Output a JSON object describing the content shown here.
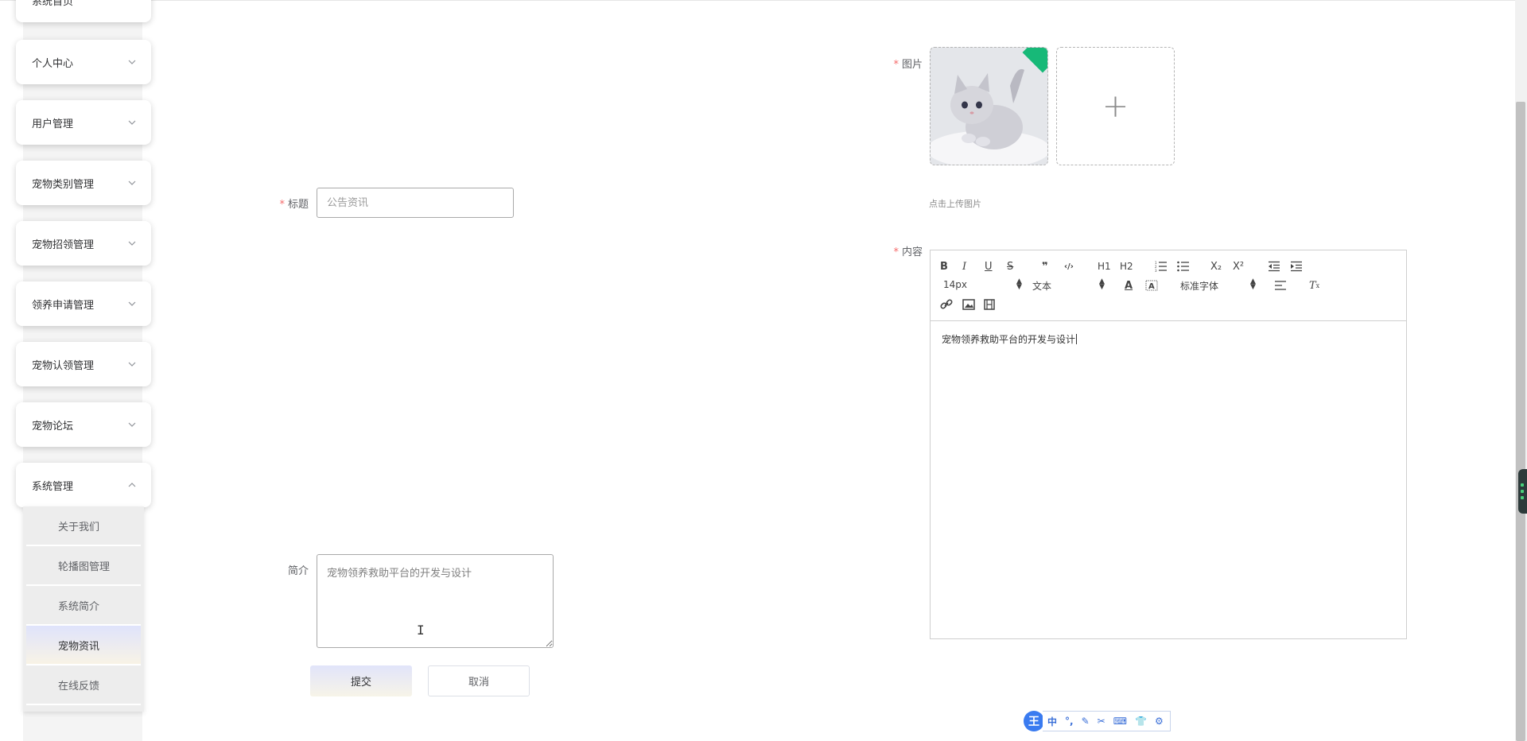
{
  "sidebar": {
    "partial_item": "系统首页",
    "items": [
      {
        "label": "个人中心",
        "expanded": false
      },
      {
        "label": "用户管理",
        "expanded": false
      },
      {
        "label": "宠物类别管理",
        "expanded": false
      },
      {
        "label": "宠物招领管理",
        "expanded": false
      },
      {
        "label": "领养申请管理",
        "expanded": false
      },
      {
        "label": "宠物认领管理",
        "expanded": false
      },
      {
        "label": "宠物论坛",
        "expanded": false
      },
      {
        "label": "系统管理",
        "expanded": true
      }
    ],
    "submenu": [
      {
        "label": "关于我们",
        "active": false
      },
      {
        "label": "轮播图管理",
        "active": false
      },
      {
        "label": "系统简介",
        "active": false
      },
      {
        "label": "宠物资讯",
        "active": true
      },
      {
        "label": "在线反馈",
        "active": false
      }
    ]
  },
  "form": {
    "title": {
      "label": "标题",
      "required": true,
      "placeholder": "公告资讯"
    },
    "image": {
      "label": "图片",
      "required": true,
      "tip": "点击上传图片",
      "add_icon": "plus-icon"
    },
    "intro": {
      "label": "简介",
      "required": false,
      "placeholder": "宠物领养救助平台的开发与设计"
    },
    "content": {
      "label": "内容",
      "required": true,
      "text": "宠物领养救助平台的开发与设计",
      "toolbar": {
        "font_size": "14px",
        "block_type": "文本",
        "font_family": "标准字体",
        "row1": [
          "B",
          "I",
          "U",
          "S",
          "❞",
          "‹/›",
          "H1",
          "H2",
          "list-ordered",
          "list-bullet",
          "X₂",
          "X²",
          "outdent",
          "indent"
        ],
        "row2_icons": [
          "text-color-icon",
          "background-color-icon",
          "align-icon",
          "clear-format-icon"
        ],
        "row3_icons": [
          "link-icon",
          "image-icon",
          "video-icon"
        ]
      }
    },
    "buttons": {
      "submit": "提交",
      "cancel": "取消"
    }
  },
  "ime": {
    "logo": "王",
    "items": [
      "中",
      "°,",
      "✎",
      "✂",
      "⌨",
      "👕",
      "⚙"
    ]
  },
  "colors": {
    "required": "#f56c6c",
    "accent": "#dfe3fb",
    "ime": "#3a7bf0"
  }
}
